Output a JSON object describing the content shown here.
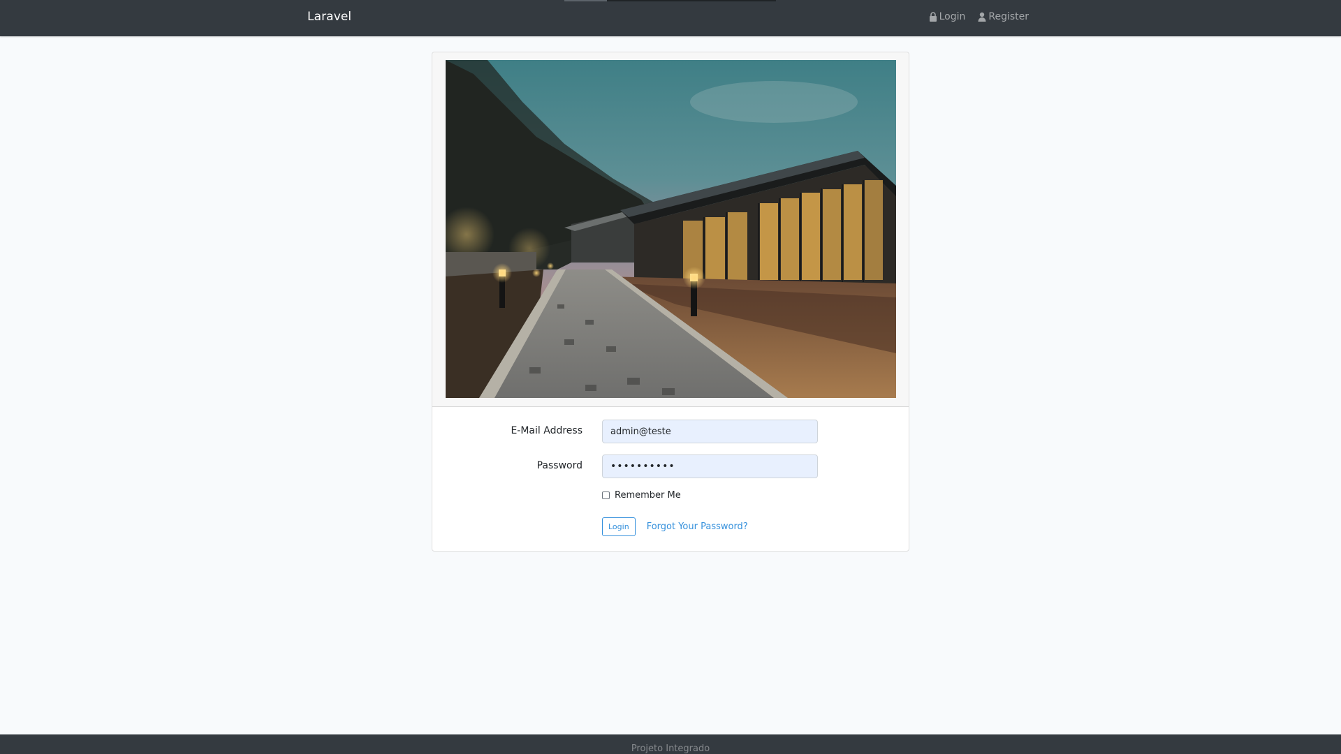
{
  "navbar": {
    "brand": "Laravel",
    "links": [
      {
        "label": "Login",
        "icon": "lock-icon"
      },
      {
        "label": "Register",
        "icon": "user-icon"
      }
    ]
  },
  "login_form": {
    "email_label": "E-Mail Address",
    "email_value": "admin@teste",
    "password_label": "Password",
    "password_value": "••••••••••",
    "remember_label": "Remember Me",
    "remember_checked": false,
    "login_button": "Login",
    "forgot_link": "Forgot Your Password?"
  },
  "footer": {
    "text": "Projeto Integrado"
  },
  "colors": {
    "navbar": "#343a40",
    "background": "#f8fafc",
    "primary": "#3490dc",
    "input_autofill": "#e8f0fe"
  }
}
